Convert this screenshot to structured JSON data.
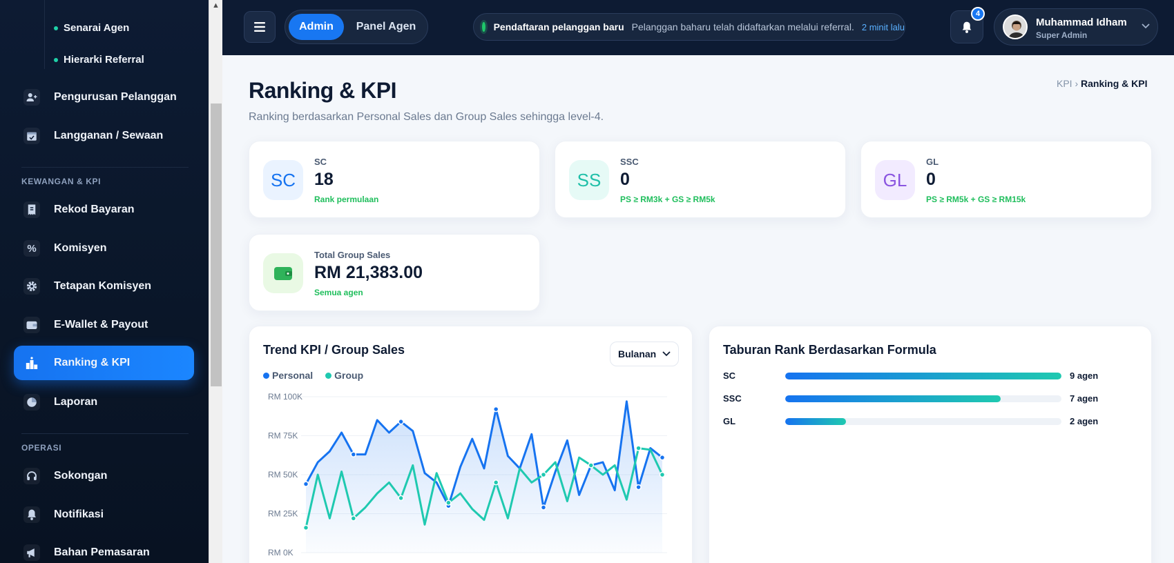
{
  "sidebar": {
    "sub_items": [
      "Senarai Agen",
      "Hierarki Referral"
    ],
    "items_top": [
      {
        "label": "Pengurusan Pelanggan",
        "icon": "user-plus-icon"
      },
      {
        "label": "Langganan / Sewaan",
        "icon": "calendar-icon"
      }
    ],
    "section_finance": "KEWANGAN & KPI",
    "items_finance": [
      {
        "label": "Rekod Bayaran",
        "icon": "receipt-icon"
      },
      {
        "label": "Komisyen",
        "icon": "percent-icon"
      },
      {
        "label": "Tetapan Komisyen",
        "icon": "gear-icon"
      },
      {
        "label": "E-Wallet & Payout",
        "icon": "wallet-icon"
      },
      {
        "label": "Ranking & KPI",
        "icon": "podium-icon",
        "active": true
      },
      {
        "label": "Laporan",
        "icon": "pie-chart-icon"
      }
    ],
    "section_ops": "OPERASI",
    "items_ops": [
      {
        "label": "Sokongan",
        "icon": "headset-icon"
      },
      {
        "label": "Notifikasi",
        "icon": "bell-icon"
      },
      {
        "label": "Bahan Pemasaran",
        "icon": "megaphone-icon"
      }
    ]
  },
  "topbar": {
    "mode_admin": "Admin",
    "mode_agent": "Panel Agen",
    "notif_title": "Pendaftaran pelanggan baru",
    "notif_text": "Pelanggan baharu telah didaftarkan melalui referral.",
    "notif_time": "2 minit lalu",
    "notif_count": "4",
    "user_name": "Muhammad Idham",
    "user_role": "Super Admin"
  },
  "page": {
    "title": "Ranking & KPI",
    "subtitle": "Ranking berdasarkan Personal Sales dan Group Sales sehingga level-4.",
    "breadcrumb_parent": "KPI",
    "breadcrumb_sep": "›",
    "breadcrumb_current": "Ranking & KPI"
  },
  "kpis": [
    {
      "abbr": "SC",
      "label": "SC",
      "value": "18",
      "note": "Rank permulaan",
      "color": "#1673f0",
      "bg": "#eaf3ff"
    },
    {
      "abbr": "SS",
      "label": "SSC",
      "value": "0",
      "note": "PS ≥ RM3k + GS ≥ RM5k",
      "color": "#1fbfa8",
      "bg": "#e6faf6"
    },
    {
      "abbr": "GL",
      "label": "GL",
      "value": "0",
      "note": "PS ≥ RM5k + GS ≥ RM15k",
      "color": "#8a55e0",
      "bg": "#f2ebff"
    }
  ],
  "total": {
    "label": "Total Group Sales",
    "value": "RM 21,383.00",
    "note": "Semua agen",
    "icon": "wallet-icon"
  },
  "trend": {
    "title": "Trend KPI / Group Sales",
    "period": "Bulanan",
    "legend_personal": "Personal",
    "legend_group": "Group"
  },
  "distribution": {
    "title": "Taburan Rank Berdasarkan Formula",
    "rows": [
      {
        "label": "SC",
        "count": "9 agen",
        "fraction": 1.0
      },
      {
        "label": "SSC",
        "count": "7 agen",
        "fraction": 0.78
      },
      {
        "label": "GL",
        "count": "2 agen",
        "fraction": 0.22
      }
    ]
  },
  "colors": {
    "accent": "#1877f2",
    "personal": "#1673f0",
    "group": "#1fc9b0",
    "success": "#1fbe5c"
  },
  "chart_data": {
    "type": "line",
    "ylim": [
      0,
      100000
    ],
    "yticks": [
      "RM 100K",
      "RM 75K",
      "RM 50K",
      "RM 25K",
      "RM 0K"
    ],
    "series": [
      {
        "name": "Personal",
        "values": [
          44000,
          58000,
          65000,
          77000,
          63000,
          63000,
          85000,
          77000,
          84000,
          78000,
          51000,
          45000,
          30000,
          55000,
          73000,
          54000,
          92000,
          62000,
          54000,
          76000,
          29000,
          52000,
          72000,
          37000,
          56000,
          58000,
          40000,
          97000,
          42000,
          67000,
          61000
        ]
      },
      {
        "name": "Group",
        "values": [
          16000,
          50000,
          22000,
          52000,
          22000,
          29000,
          38000,
          45000,
          35000,
          56000,
          18000,
          51000,
          32000,
          38000,
          28000,
          21000,
          45000,
          22000,
          54000,
          45000,
          50000,
          58000,
          33000,
          61000,
          56000,
          50000,
          56000,
          34000,
          67000,
          66000,
          50000
        ]
      }
    ]
  }
}
